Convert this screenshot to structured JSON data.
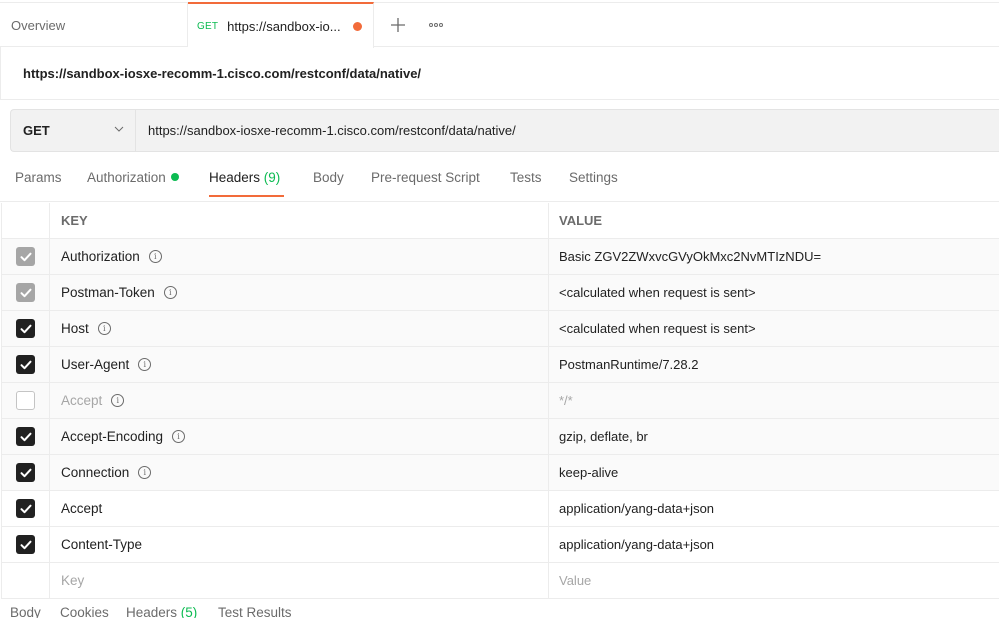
{
  "tabs": {
    "overview_label": "Overview",
    "active_request": {
      "method": "GET",
      "title": "https://sandbox-io...",
      "unsaved": true
    },
    "add_tab_icon": "plus-icon",
    "more_icon": "ellipsis-icon"
  },
  "request": {
    "name": "https://sandbox-iosxe-recomm-1.cisco.com/restconf/data/native/",
    "method": "GET",
    "url": "https://sandbox-iosxe-recomm-1.cisco.com/restconf/data/native/"
  },
  "request_tabs": [
    {
      "label": "Params"
    },
    {
      "label": "Authorization",
      "indicator": "green-dot"
    },
    {
      "label": "Headers",
      "count": "(9)",
      "active": true
    },
    {
      "label": "Body"
    },
    {
      "label": "Pre-request Script"
    },
    {
      "label": "Tests"
    },
    {
      "label": "Settings"
    }
  ],
  "headers_table": {
    "columns": {
      "key": "KEY",
      "value": "VALUE"
    },
    "rows": [
      {
        "key": "Authorization",
        "value": "Basic ZGV2ZWxvcGVyOkMxc2NvMTIzNDU=",
        "checkbox": "locked",
        "auto": true,
        "info": true
      },
      {
        "key": "Postman-Token",
        "value": "<calculated when request is sent>",
        "checkbox": "locked",
        "auto": true,
        "info": true
      },
      {
        "key": "Host",
        "value": "<calculated when request is sent>",
        "checkbox": "checked",
        "auto": true,
        "info": true
      },
      {
        "key": "User-Agent",
        "value": "PostmanRuntime/7.28.2",
        "checkbox": "checked",
        "auto": true,
        "info": true
      },
      {
        "key": "Accept",
        "value": "*/*",
        "checkbox": "unchecked",
        "auto": true,
        "info": true
      },
      {
        "key": "Accept-Encoding",
        "value": "gzip, deflate, br",
        "checkbox": "checked",
        "auto": true,
        "info": true
      },
      {
        "key": "Connection",
        "value": "keep-alive",
        "checkbox": "checked",
        "auto": true,
        "info": true
      },
      {
        "key": "Accept",
        "value": "application/yang-data+json",
        "checkbox": "checked",
        "auto": false,
        "info": false
      },
      {
        "key": "Content-Type",
        "value": "application/yang-data+json",
        "checkbox": "checked",
        "auto": false,
        "info": false
      }
    ],
    "new_row": {
      "key_placeholder": "Key",
      "value_placeholder": "Value"
    }
  },
  "response_tabs": [
    {
      "label": "Body"
    },
    {
      "label": "Cookies"
    },
    {
      "label": "Headers",
      "count": "(5)"
    },
    {
      "label": "Test Results"
    }
  ],
  "colors": {
    "accent": "#f26b3a",
    "success": "#0cbb52",
    "text": "#212121",
    "muted": "#6b6b6b"
  }
}
